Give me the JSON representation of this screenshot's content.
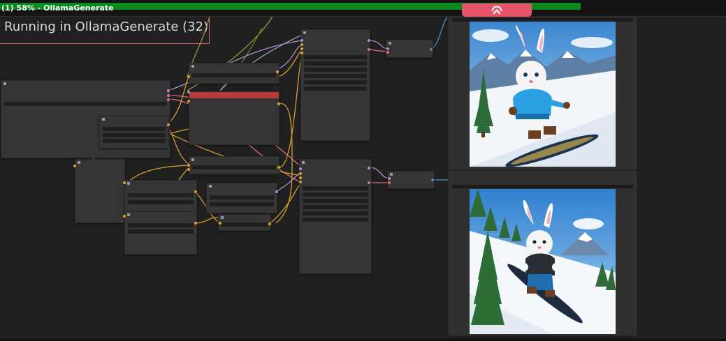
{
  "window": {
    "title": "(1) 58% - OllamaGenerate",
    "progress": 0.8
  },
  "queue_button": {
    "icon": "chevron-up-icon",
    "color": "#e8546a"
  },
  "status": {
    "text": "Running in OllamaGenerate (32)",
    "border_color": "#d45f6a"
  },
  "colors": {
    "canvas": "#202020",
    "node": "#353535",
    "active_node_header": "#b83a3a",
    "progress": "#0a8a1e"
  },
  "previews": [
    {
      "subject": "white rabbit in blue jacket snowboarding down a snowy slope"
    },
    {
      "subject": "white rabbit in black jacket and blue pants snowboarding among pine trees"
    }
  ]
}
